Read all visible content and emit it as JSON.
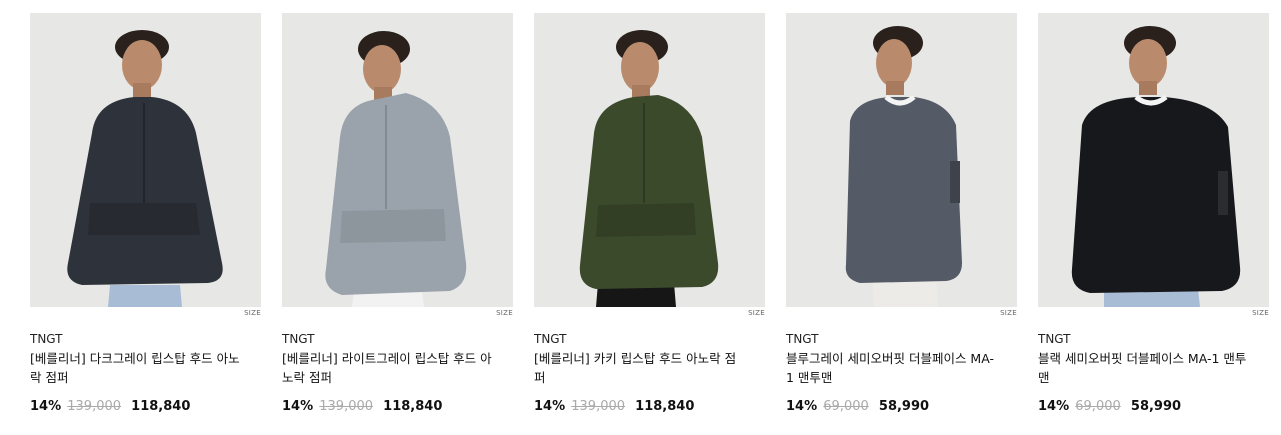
{
  "products": [
    {
      "brand": "TNGT",
      "title": "[베를리너] 다크그레이 립스탑 후드 아노락 점퍼",
      "discount": "14%",
      "original_price": "139,000",
      "sale_price": "118,840",
      "size_label": "SIZE",
      "garment_color": "#2e323a"
    },
    {
      "brand": "TNGT",
      "title": "[베를리너] 라이트그레이 립스탑 후드 아노락 점퍼",
      "discount": "14%",
      "original_price": "139,000",
      "sale_price": "118,840",
      "size_label": "SIZE",
      "garment_color": "#9aa2ab"
    },
    {
      "brand": "TNGT",
      "title": "[베를리너] 카키 립스탑 후드 아노락 점퍼",
      "discount": "14%",
      "original_price": "139,000",
      "sale_price": "118,840",
      "size_label": "SIZE",
      "garment_color": "#3c4a2c"
    },
    {
      "brand": "TNGT",
      "title": "블루그레이 세미오버핏 더블페이스 MA-1 맨투맨",
      "discount": "14%",
      "original_price": "69,000",
      "sale_price": "58,990",
      "size_label": "SIZE",
      "garment_color": "#555b66"
    },
    {
      "brand": "TNGT",
      "title": "블랙 세미오버핏 더블페이스 MA-1 맨투맨",
      "discount": "14%",
      "original_price": "69,000",
      "sale_price": "58,990",
      "size_label": "SIZE",
      "garment_color": "#17181b"
    }
  ]
}
